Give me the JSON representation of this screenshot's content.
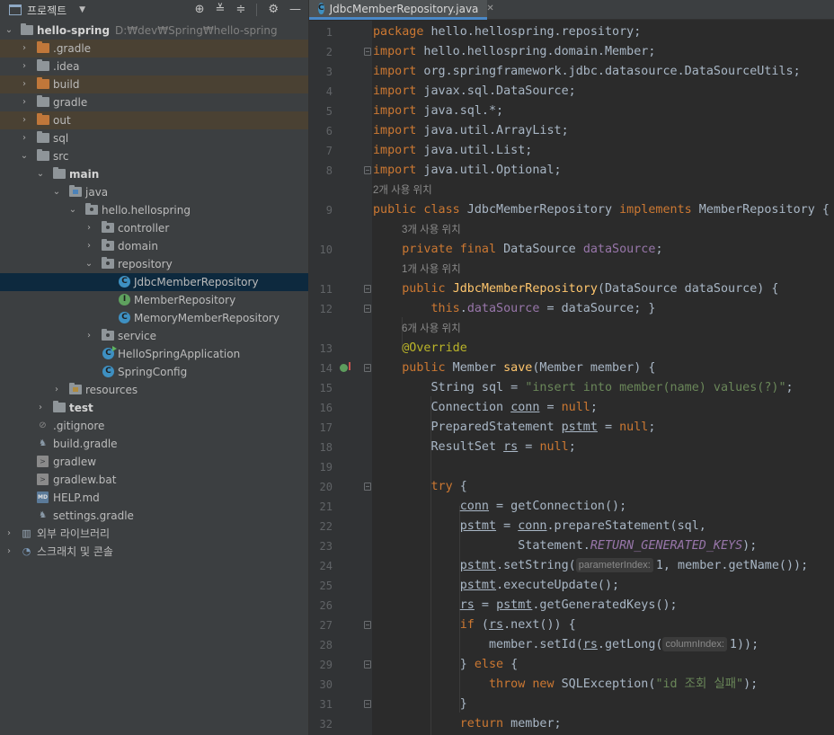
{
  "project_panel": {
    "title": "프로젝트",
    "dropdown_icon": "chevron-down-icon",
    "tools": [
      "crosshair-icon",
      "expand-all-icon",
      "collapse-all-icon",
      "gear-icon",
      "minimize-icon"
    ],
    "tree": [
      {
        "label": "hello-spring",
        "hint": "D:₩dev₩Spring₩hello-spring",
        "icon": "folder-icon",
        "state": "expanded",
        "style": "bold"
      },
      {
        "label": ".gradle",
        "icon": "folder-orange-icon",
        "state": "collapsed",
        "style": "excluded"
      },
      {
        "label": ".idea",
        "icon": "folder-icon",
        "state": "collapsed"
      },
      {
        "label": "build",
        "icon": "folder-orange-icon",
        "state": "collapsed",
        "style": "excluded"
      },
      {
        "label": "gradle",
        "icon": "folder-icon",
        "state": "collapsed"
      },
      {
        "label": "out",
        "icon": "folder-orange-icon",
        "state": "collapsed",
        "style": "excluded"
      },
      {
        "label": "sql",
        "icon": "folder-icon",
        "state": "collapsed"
      },
      {
        "label": "src",
        "icon": "folder-icon",
        "state": "expanded"
      },
      {
        "label": "main",
        "icon": "folder-icon",
        "state": "expanded",
        "style": "bold"
      },
      {
        "label": "java",
        "icon": "source-folder-icon",
        "state": "expanded"
      },
      {
        "label": "hello.hellospring",
        "icon": "package-icon",
        "state": "expanded"
      },
      {
        "label": "controller",
        "icon": "package-icon",
        "state": "collapsed"
      },
      {
        "label": "domain",
        "icon": "package-icon",
        "state": "collapsed"
      },
      {
        "label": "repository",
        "icon": "package-icon",
        "state": "expanded"
      },
      {
        "label": "JdbcMemberRepository",
        "icon": "class-icon",
        "style": "selected"
      },
      {
        "label": "MemberRepository",
        "icon": "interface-icon"
      },
      {
        "label": "MemoryMemberRepository",
        "icon": "class-icon"
      },
      {
        "label": "service",
        "icon": "package-icon",
        "state": "collapsed"
      },
      {
        "label": "HelloSpringApplication",
        "icon": "spring-boot-class-icon"
      },
      {
        "label": "SpringConfig",
        "icon": "class-icon"
      },
      {
        "label": "resources",
        "icon": "resources-folder-icon",
        "state": "collapsed"
      },
      {
        "label": "test",
        "icon": "folder-icon",
        "state": "collapsed",
        "style": "bold"
      },
      {
        "label": ".gitignore",
        "icon": "gitignore-icon"
      },
      {
        "label": "build.gradle",
        "icon": "gradle-icon"
      },
      {
        "label": "gradlew",
        "icon": "terminal-file-icon"
      },
      {
        "label": "gradlew.bat",
        "icon": "terminal-file-icon"
      },
      {
        "label": "HELP.md",
        "icon": "markdown-icon"
      },
      {
        "label": "settings.gradle",
        "icon": "gradle-icon"
      },
      {
        "label": "외부 라이브러리",
        "icon": "library-icon",
        "state": "collapsed"
      },
      {
        "label": "스크래치 및 콘솔",
        "icon": "console-icon",
        "state": "collapsed"
      }
    ]
  },
  "editor": {
    "tab": {
      "label": "JdbcMemberRepository.java",
      "close_icon": "close-icon"
    },
    "colors": {
      "keyword": "#cc7832",
      "string": "#6a8759",
      "field": "#9876aa",
      "method": "#ffc66d",
      "annotation": "#bbb529",
      "default": "#a9b7c6"
    },
    "hints": {
      "usage_2": "2개 사용 위치",
      "usage_3": "3개 사용 위치",
      "usage_1": "1개 사용 위치",
      "usage_6": "6개 사용 위치",
      "param_parameterIndex": "parameterIndex:",
      "param_columnIndex": "columnIndex:"
    },
    "lines": [
      {
        "n": "1",
        "text": "package hello.hellospring.repository;"
      },
      {
        "n": "2",
        "text": "import hello.hellospring.domain.Member;"
      },
      {
        "n": "3",
        "text": "import org.springframework.jdbc.datasource.DataSourceUtils;"
      },
      {
        "n": "4",
        "text": "import javax.sql.DataSource;"
      },
      {
        "n": "5",
        "text": "import java.sql.*;"
      },
      {
        "n": "6",
        "text": "import java.util.ArrayList;"
      },
      {
        "n": "7",
        "text": "import java.util.List;"
      },
      {
        "n": "8",
        "text": "import java.util.Optional;"
      },
      {
        "n": "9",
        "text": "public class JdbcMemberRepository implements MemberRepository {"
      },
      {
        "n": "10",
        "text": "private final DataSource dataSource;"
      },
      {
        "n": "11",
        "text": "public JdbcMemberRepository(DataSource dataSource) {"
      },
      {
        "n": "12",
        "text": "this.dataSource = dataSource; }"
      },
      {
        "n": "13",
        "text": "@Override"
      },
      {
        "n": "14",
        "text": "public Member save(Member member) {"
      },
      {
        "n": "15",
        "text": "String sql = \"insert into member(name) values(?)\";"
      },
      {
        "n": "16",
        "text": "Connection conn = null;"
      },
      {
        "n": "17",
        "text": "PreparedStatement pstmt = null;"
      },
      {
        "n": "18",
        "text": "ResultSet rs = null;"
      },
      {
        "n": "19",
        "text": ""
      },
      {
        "n": "20",
        "text": "try {"
      },
      {
        "n": "21",
        "text": "conn = getConnection();"
      },
      {
        "n": "22",
        "text": "pstmt = conn.prepareStatement(sql,"
      },
      {
        "n": "23",
        "text": "Statement.RETURN_GENERATED_KEYS);"
      },
      {
        "n": "24",
        "text": "pstmt.setString(1, member.getName());"
      },
      {
        "n": "25",
        "text": "pstmt.executeUpdate();"
      },
      {
        "n": "26",
        "text": "rs = pstmt.getGeneratedKeys();"
      },
      {
        "n": "27",
        "text": "if (rs.next()) {"
      },
      {
        "n": "28",
        "text": "member.setId(rs.getLong(1));"
      },
      {
        "n": "29",
        "text": "} else {"
      },
      {
        "n": "30",
        "text": "throw new SQLException(\"id 조회 실패\");"
      },
      {
        "n": "31",
        "text": "}"
      },
      {
        "n": "32",
        "text": "return member;"
      }
    ]
  }
}
